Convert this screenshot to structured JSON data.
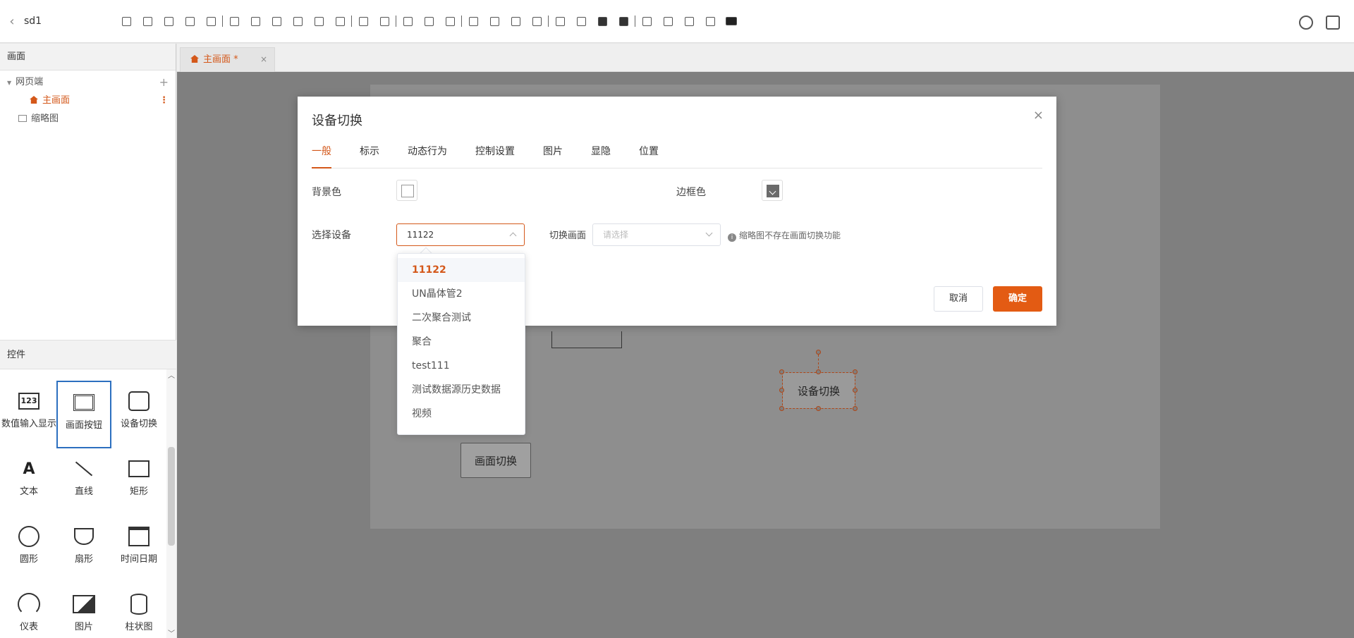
{
  "app": {
    "title": "sd1"
  },
  "left_panel": {
    "screens_header": "画面",
    "tree": {
      "root_label": "网页端",
      "child_label": "主画面",
      "thumb_label": "缩略图"
    },
    "controls_header": "控件",
    "controls": [
      {
        "label": "数值输入显示",
        "icon": "numeric-icon"
      },
      {
        "label": "画面按钮",
        "icon": "screen-button-icon"
      },
      {
        "label": "设备切换",
        "icon": "device-switch-icon"
      },
      {
        "label": "文本",
        "icon": "text-icon"
      },
      {
        "label": "直线",
        "icon": "line-icon"
      },
      {
        "label": "矩形",
        "icon": "rectangle-icon"
      },
      {
        "label": "圆形",
        "icon": "circle-icon"
      },
      {
        "label": "扇形",
        "icon": "sector-icon"
      },
      {
        "label": "时间日期",
        "icon": "calendar-icon"
      },
      {
        "label": "仪表",
        "icon": "gauge-icon"
      },
      {
        "label": "图片",
        "icon": "image-icon"
      },
      {
        "label": "柱状图",
        "icon": "cylinder-icon"
      }
    ]
  },
  "editor_tab": {
    "label": "主画面 *",
    "close": "×"
  },
  "canvas": {
    "widgets": {
      "screen_switch_label": "画面切换",
      "device_switch_label": "设备切换"
    }
  },
  "dialog": {
    "title": "设备切换",
    "close": "×",
    "tabs": [
      "一般",
      "标示",
      "动态行为",
      "控制设置",
      "图片",
      "显隐",
      "位置"
    ],
    "active_tab": "一般",
    "bg_color_label": "背景色",
    "border_color_label": "边框色",
    "select_device_label": "选择设备",
    "select_device_value": "11122",
    "switch_screen_label": "切换画面",
    "switch_screen_placeholder": "请选择",
    "info_text": "缩略图不存在画面切换功能",
    "info_icon": "i",
    "cancel_label": "取消",
    "ok_label": "确定"
  },
  "dropdown": {
    "options": [
      "11122",
      "UN晶体管2",
      "二次聚合测试",
      "聚合",
      "test111",
      "测试数据源历史数据",
      "视频"
    ],
    "selected": "11122"
  },
  "colors": {
    "accent": "#d4581a",
    "primary_button": "#e35b13",
    "selection_border": "#2c6fbf"
  }
}
